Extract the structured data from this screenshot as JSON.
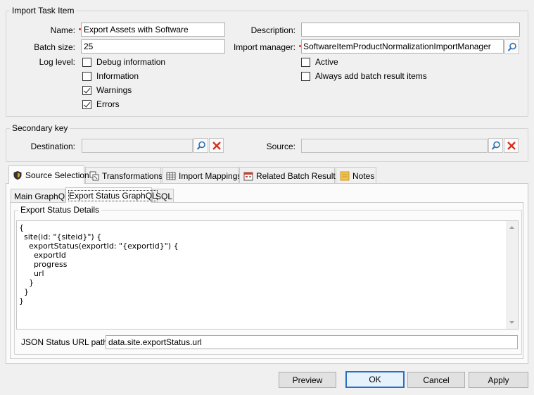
{
  "import_task": {
    "legend": "Import Task Item",
    "name_label": "Name:",
    "name_value": "Export Assets with Software",
    "batch_label": "Batch size:",
    "batch_value": "25",
    "log_label": "Log level:",
    "log_levels": [
      {
        "label": "Debug information",
        "checked": false
      },
      {
        "label": "Information",
        "checked": false
      },
      {
        "label": "Warnings",
        "checked": true
      },
      {
        "label": "Errors",
        "checked": true
      }
    ],
    "description_label": "Description:",
    "description_value": "",
    "manager_label": "Import manager:",
    "manager_value": "SoftwareItemProductNormalizationImportManager",
    "active_label": "Active",
    "active_checked": false,
    "always_add_label": "Always add batch result items",
    "always_add_checked": false
  },
  "secondary_key": {
    "legend": "Secondary key",
    "destination_label": "Destination:",
    "destination_value": "",
    "source_label": "Source:",
    "source_value": ""
  },
  "tabs": [
    {
      "label": "Source Selection",
      "icon": "shield-icon",
      "active": true
    },
    {
      "label": "Transformations",
      "icon": "transform-icon",
      "active": false
    },
    {
      "label": "Import Mappings",
      "icon": "grid-icon",
      "active": false
    },
    {
      "label": "Related Batch Results",
      "icon": "calendar-icon",
      "active": false
    },
    {
      "label": "Notes",
      "icon": "note-icon",
      "active": false
    }
  ],
  "subtabs": [
    {
      "label": "Main GraphQL",
      "active": false
    },
    {
      "label": "Export Status GraphQL",
      "active": true
    },
    {
      "label": "SQL",
      "active": false
    }
  ],
  "status_details": {
    "legend": "Export Status Details",
    "query": "{\n  site(id: \"{siteid}\") {\n    exportStatus(exportId: \"{exportid}\") {\n      exportId\n      progress\n      url\n    }\n  }\n}",
    "json_path_label": "JSON Status URL path:",
    "json_path_value": "data.site.exportStatus.url"
  },
  "buttons": {
    "preview": "Preview",
    "ok": "OK",
    "cancel": "Cancel",
    "apply": "Apply"
  },
  "colors": {
    "accent_border": "#2a6ec6",
    "required_marker": "#e0301e",
    "delete_red": "#d9301f",
    "search_blue": "#2c6fb0"
  }
}
